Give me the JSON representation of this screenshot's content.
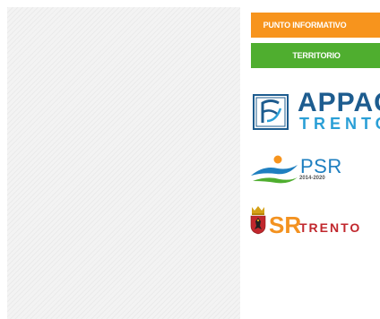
{
  "sidebar": {
    "buttons": [
      {
        "label": "PUNTO INFORMATIVO",
        "color": "#f7941d"
      },
      {
        "label": "TERRITORIO",
        "color": "#4fae2f"
      }
    ],
    "logos": {
      "appag": {
        "icon": "appag-logo-icon",
        "title": "APPAG",
        "subtitle": "TRENTO"
      },
      "psr": {
        "icon": "psr-wave-icon",
        "title": "PSR",
        "years": "2014-2020"
      },
      "srtrento": {
        "icon": "trentino-crest-icon",
        "big": "SR",
        "small": "TRENTO"
      }
    }
  },
  "colors": {
    "orange": "#f7941d",
    "green": "#4fae2f",
    "appag_blue": "#1d5c8f",
    "appag_light_blue": "#2a9fd6",
    "psr_blue": "#1e7fc0",
    "sr_orange": "#f39220",
    "sr_red": "#c1272d"
  }
}
